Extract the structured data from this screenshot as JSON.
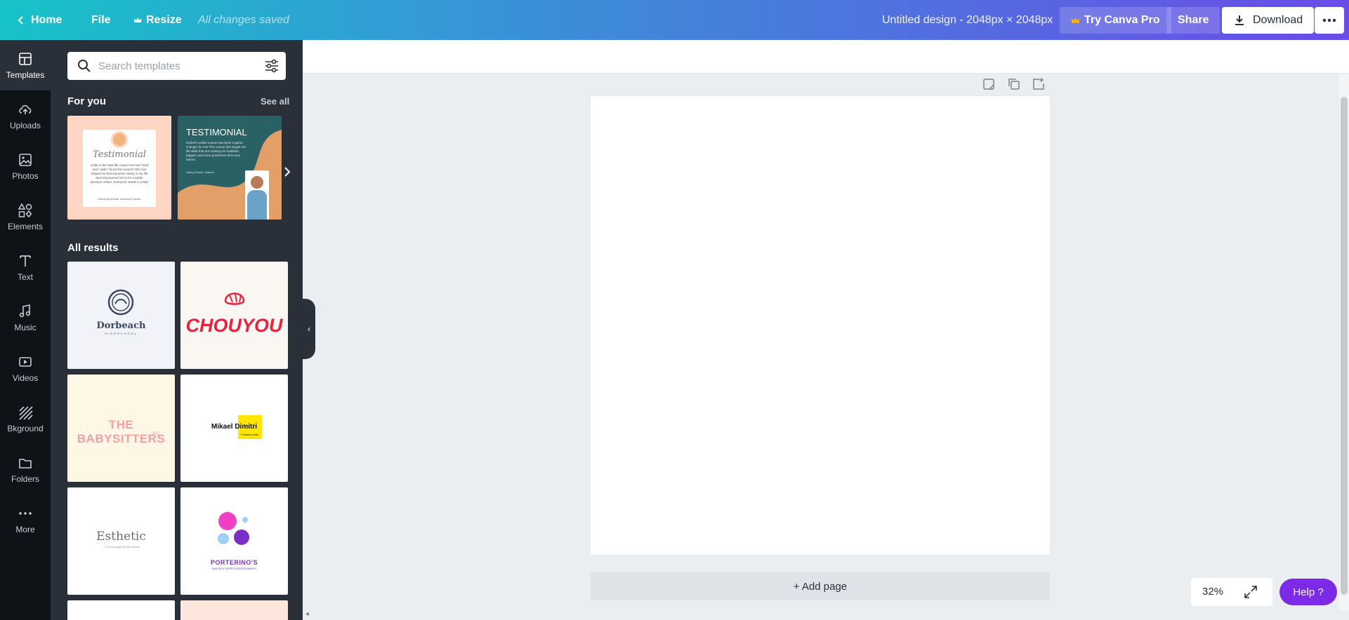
{
  "topbar": {
    "home_label": "Home",
    "file_label": "File",
    "resize_label": "Resize",
    "saved_status": "All changes saved",
    "design_title": "Untitled design - 2048px × 2048px",
    "try_pro_label": "Try Canva Pro",
    "share_label": "Share",
    "download_label": "Download"
  },
  "rail": {
    "items": [
      {
        "label": "Templates",
        "icon": "templates-icon"
      },
      {
        "label": "Uploads",
        "icon": "upload-cloud-icon"
      },
      {
        "label": "Photos",
        "icon": "photo-icon"
      },
      {
        "label": "Elements",
        "icon": "shapes-icon"
      },
      {
        "label": "Text",
        "icon": "text-icon"
      },
      {
        "label": "Music",
        "icon": "music-note-icon"
      },
      {
        "label": "Videos",
        "icon": "video-icon"
      },
      {
        "label": "Bkground",
        "icon": "background-hatch-icon"
      },
      {
        "label": "Folders",
        "icon": "folder-icon"
      },
      {
        "label": "More",
        "icon": "dots-icon"
      }
    ]
  },
  "panel": {
    "search_placeholder": "Search templates",
    "for_you_title": "For you",
    "see_all_label": "See all",
    "all_results_title": "All results",
    "for_you_templates": [
      {
        "title": "Testimonial",
        "body": "Linda is the best life coach I've ever hired and I wish I found her sooner! She has helped me find immense clarity in my life and empowered me to be a better decision maker. Everyone needs a Linda!",
        "credit": "Diana McDonald, Business Owner"
      },
      {
        "title": "TESTIMONIAL",
        "body": "Robert's online course has been a game changer for me! The course has taught me life skills that are making me healthier, happier and more productive than ever before.",
        "credit": "Danny Evans, Student"
      }
    ],
    "results": [
      {
        "name": "Dorbeach",
        "sub": "HIGHSCHOOL"
      },
      {
        "name": "CHOUYOU",
        "sub": ""
      },
      {
        "name": "THE BABYSITTERS",
        "sub": "INC."
      },
      {
        "name": "Mikael Dimitri",
        "sub": "Freelance writer"
      },
      {
        "name": "Esthetic",
        "sub": "Dermatologia de laboratorio"
      },
      {
        "name": "PORTERINO'S",
        "sub": "SNACKS & SPORTS ENTERTAINMENT"
      }
    ]
  },
  "workspace": {
    "add_page_label": "+ Add page",
    "zoom_label": "32%",
    "help_label": "Help ?"
  },
  "colors": {
    "gradient_start": "#17c3c9",
    "gradient_end": "#6a4ce8",
    "help_purple": "#7d2ae8",
    "panel_bg": "#293039",
    "rail_bg": "#0e1318"
  }
}
